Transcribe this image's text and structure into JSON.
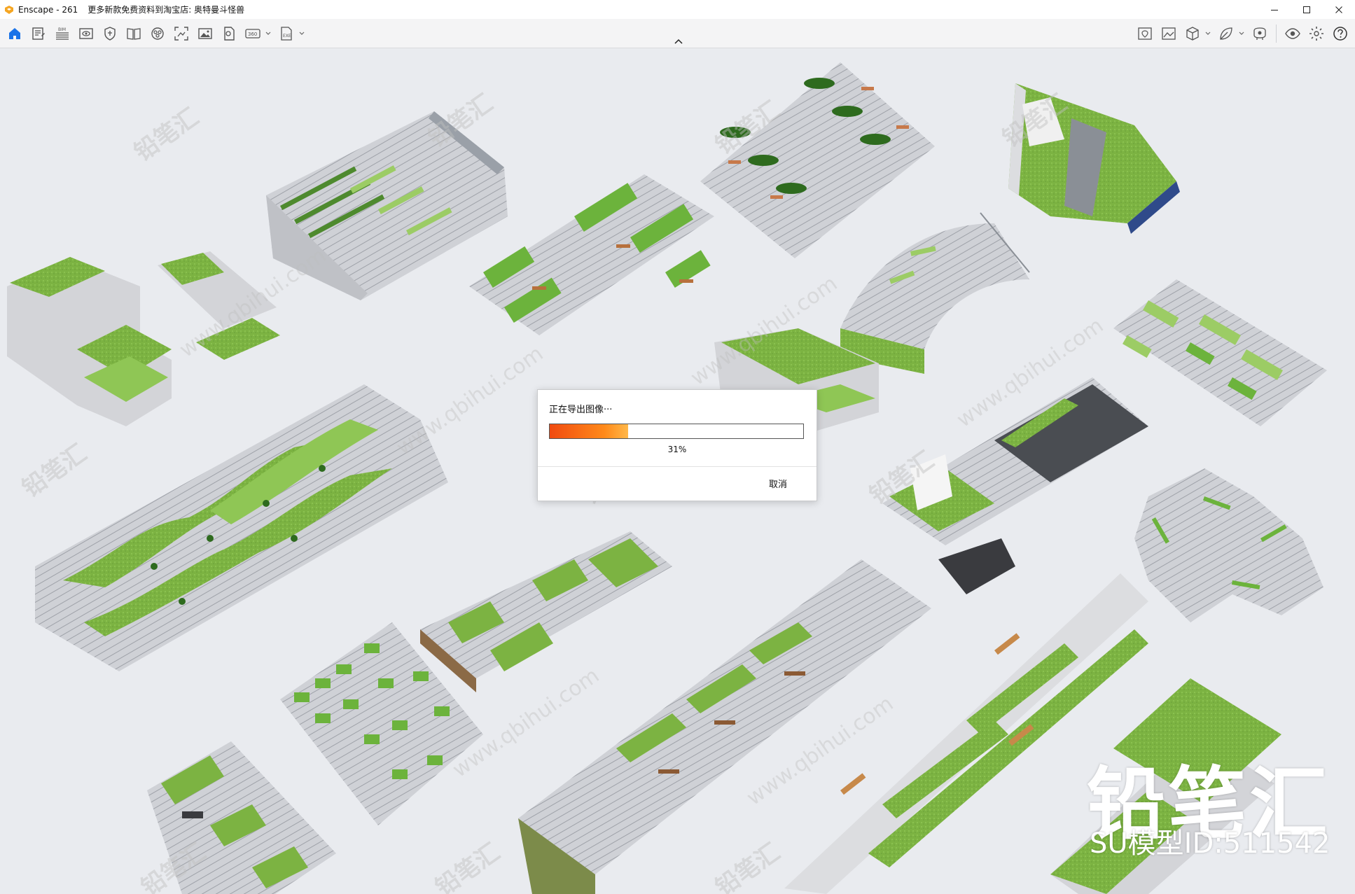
{
  "window": {
    "app_name": "Enscape - 261",
    "title_note": "更多新款免费资料到淘宝店: 奥特曼斗怪兽",
    "minimize_icon": "minimize-icon",
    "maximize_icon": "maximize-icon",
    "close_icon": "close-icon"
  },
  "toolbar": {
    "left_icons": [
      "home-icon",
      "notes-icon",
      "bim-icon",
      "view-icon",
      "shield-icon",
      "book-icon",
      "video-icon",
      "screenshot-icon",
      "image-icon",
      "tag-icon",
      "panorama-360-icon",
      "exe-export-icon"
    ],
    "right_icons": [
      "map-icon",
      "export-image-icon",
      "cube-icon",
      "leaf-icon",
      "asset-library-icon",
      "eye-icon",
      "settings-icon",
      "help-icon"
    ],
    "bim_label": "BIM",
    "panorama_label": "360",
    "exe_label": "EXE"
  },
  "dialog": {
    "message": "正在导出图像···",
    "progress_percent": 31,
    "progress_label": "31%",
    "cancel_label": "取消"
  },
  "watermark": {
    "brand": "铅笔汇",
    "model_id": "SU模型ID:511542",
    "repeat_brand": "铅笔汇",
    "repeat_url": "www.qbihui.com"
  },
  "colors": {
    "accent_orange": "#f5a623",
    "home_blue": "#1a73e8",
    "progress_orange": "#ff6a1a",
    "grass": "#7cb342",
    "dark_grass": "#4e8a2e",
    "concrete": "#c9cbd0"
  }
}
